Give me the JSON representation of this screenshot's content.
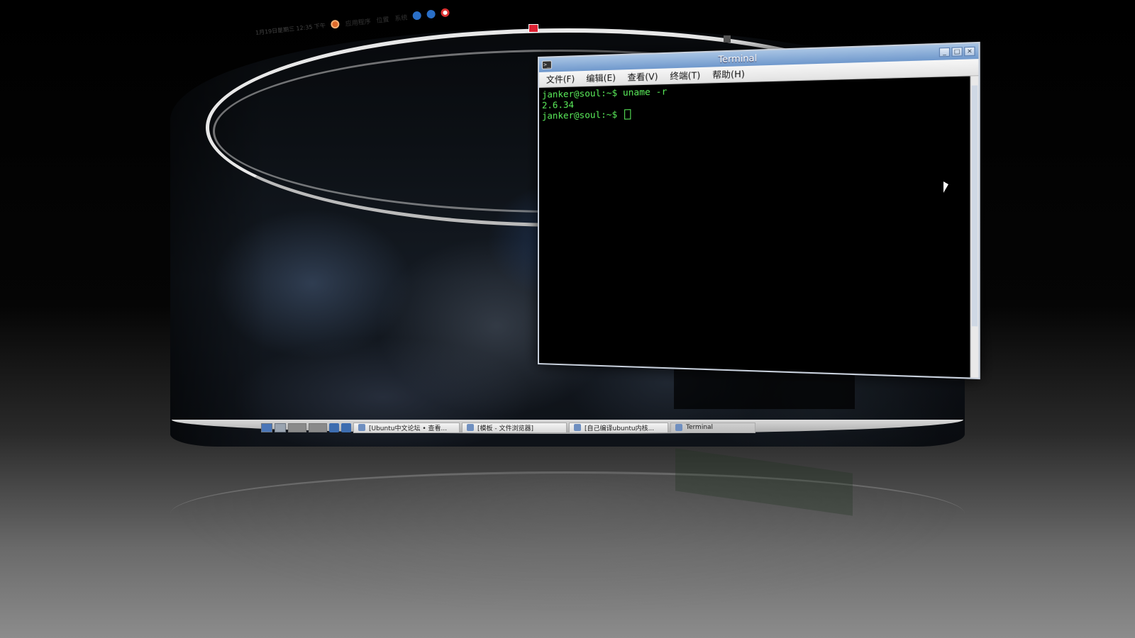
{
  "top_panel": {
    "clock": "1月19日星期三 12:35 下午",
    "menus": [
      "应用程序",
      "位置",
      "系统"
    ]
  },
  "terminal": {
    "title": "Terminal",
    "menus": [
      "文件(F)",
      "编辑(E)",
      "查看(V)",
      "终端(T)",
      "帮助(H)"
    ],
    "lines": [
      "janker@soul:~$ uname -r",
      "2.6.34",
      "janker@soul:~$ "
    ],
    "icon": "terminal-icon"
  },
  "taskbar": {
    "tasks": [
      "[Ubuntu中文论坛 • 查看...",
      "[模板 - 文件浏览器]",
      "[自己编译ubuntu内核...",
      "Terminal"
    ]
  },
  "colors": {
    "terminal_text": "#5cf05c",
    "titlebar": "#6f98cc",
    "desktop_bg": "#000000"
  }
}
